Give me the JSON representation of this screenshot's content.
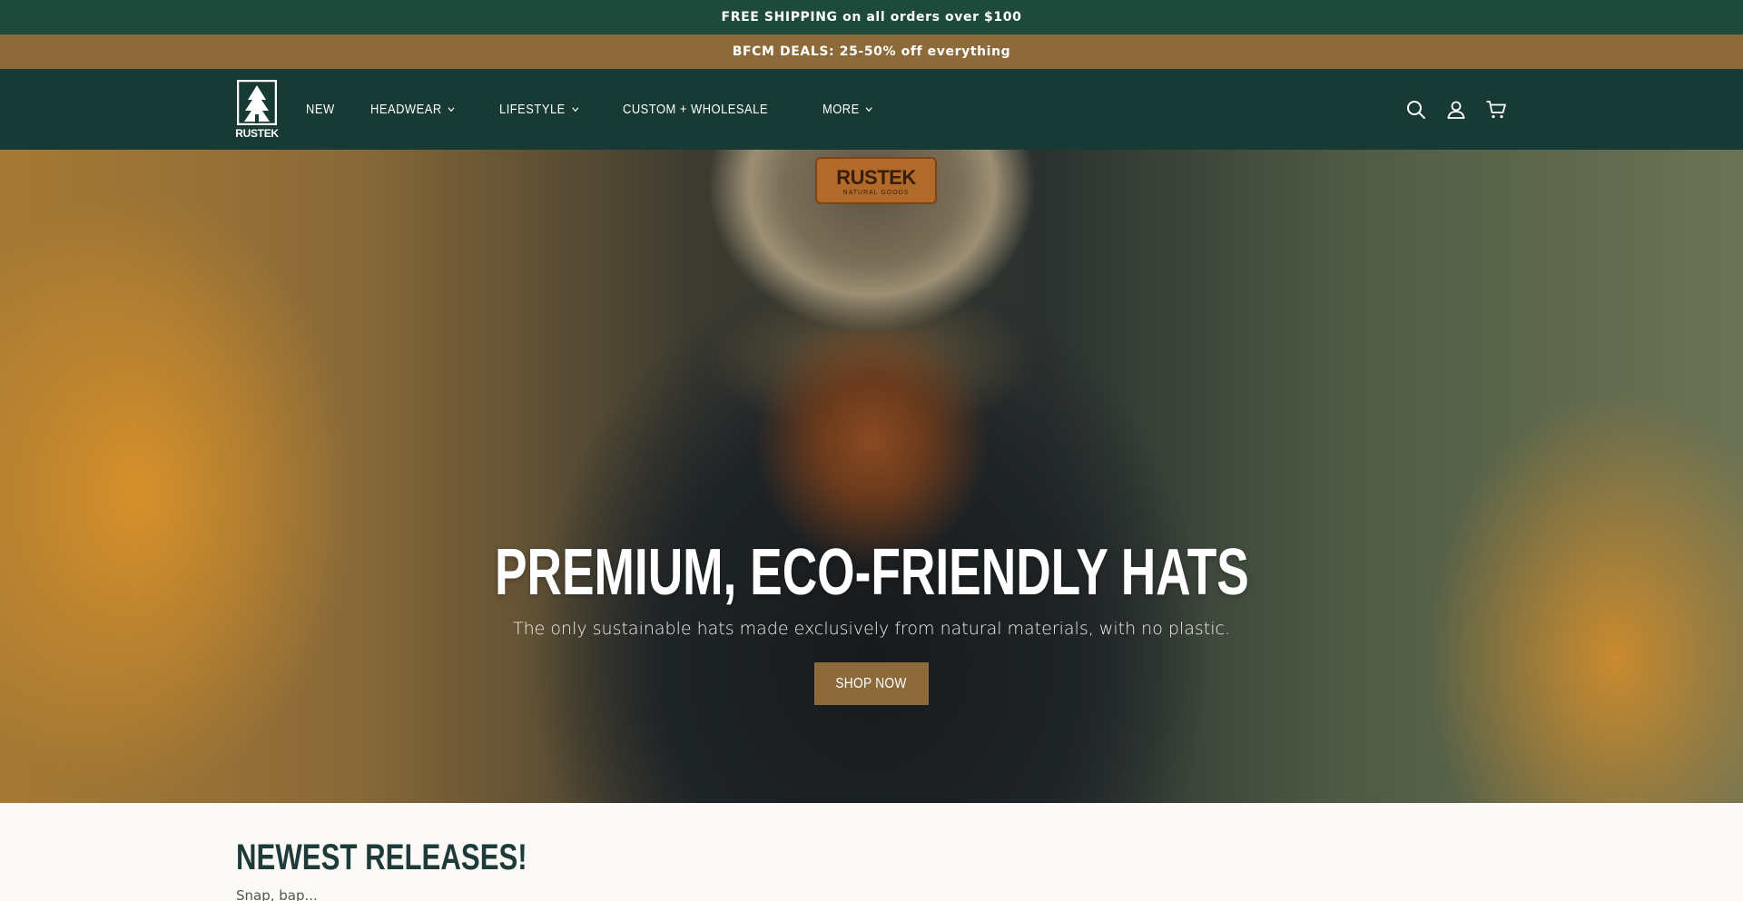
{
  "announcements": {
    "shipping": "FREE SHIPPING on all orders over $100",
    "deals": "BFCM DEALS: 25-50% off everything"
  },
  "header": {
    "logo_text": "RUSTEK",
    "nav": [
      {
        "label": "NEW",
        "dropdown": false
      },
      {
        "label": "HEADWEAR",
        "dropdown": true
      },
      {
        "label": "LIFESTYLE",
        "dropdown": true
      },
      {
        "label": "CUSTOM + WHOLESALE",
        "dropdown": false
      },
      {
        "label": "MORE",
        "dropdown": true
      }
    ],
    "icons": [
      "search-icon",
      "account-icon",
      "cart-icon"
    ]
  },
  "hero": {
    "patch_brand": "RUSTEK",
    "patch_sub": "NATURAL GOODS",
    "title": "PREMIUM, ECO-FRIENDLY HATS",
    "subtitle": "The only sustainable hats made exclusively from natural materials, with no plastic.",
    "cta": "SHOP NOW"
  },
  "newest": {
    "heading": "NEWEST RELEASES!",
    "subtext": "Snap, bap..."
  },
  "colors": {
    "shipping_bar": "#1e4a3c",
    "deal_bar": "#8c6a3a",
    "header": "#173a35",
    "accent": "#8c6a3a"
  }
}
